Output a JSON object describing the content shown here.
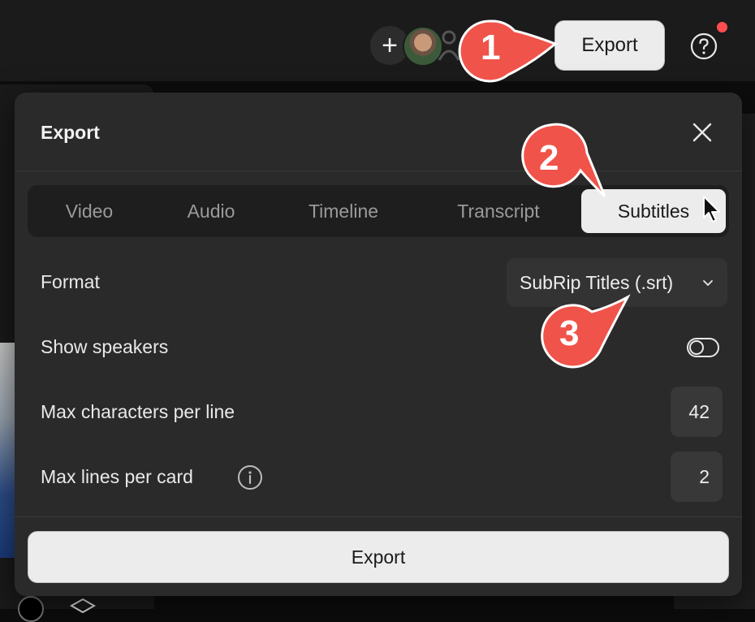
{
  "topbar": {
    "export_label": "Export"
  },
  "modal": {
    "title": "Export",
    "tabs": [
      {
        "label": "Video"
      },
      {
        "label": "Audio"
      },
      {
        "label": "Timeline"
      },
      {
        "label": "Transcript"
      },
      {
        "label": "Subtitles"
      }
    ],
    "active_tab": "Subtitles",
    "format": {
      "label": "Format",
      "value": "SubRip Titles (.srt)"
    },
    "show_speakers": {
      "label": "Show speakers",
      "on": false
    },
    "max_chars": {
      "label": "Max characters per line",
      "value": "42"
    },
    "max_lines": {
      "label": "Max lines per card",
      "value": "2"
    },
    "export_button": "Export"
  },
  "callouts": [
    {
      "number": "1"
    },
    {
      "number": "2"
    },
    {
      "number": "3"
    }
  ],
  "colors": {
    "callout": "#f0534a",
    "modal_bg": "#2a2a2a",
    "button_bg": "#ececec",
    "notification": "#ff4d4f"
  }
}
